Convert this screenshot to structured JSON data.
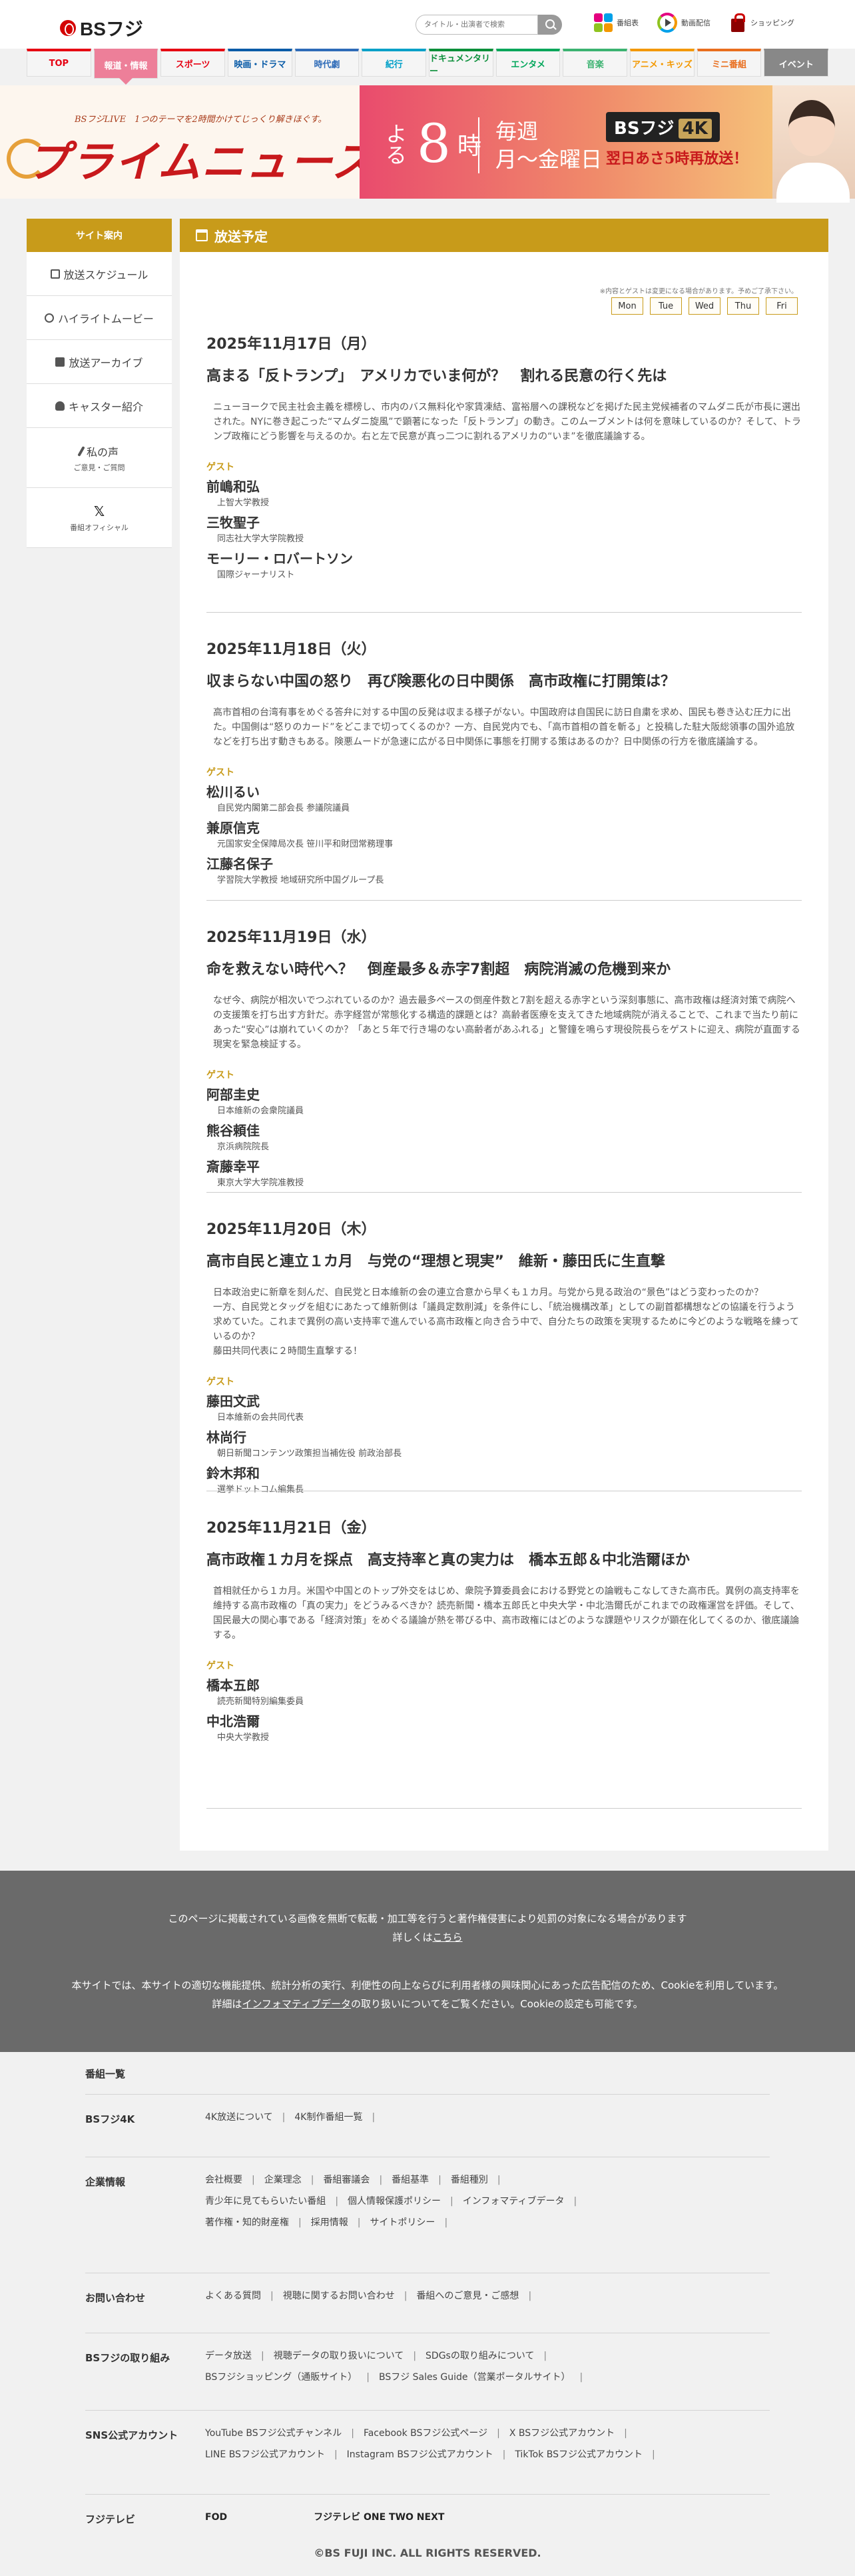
{
  "header": {
    "logo": "BSフジ",
    "search_placeholder": "タイトル・出演者で検索",
    "links": [
      {
        "label": "番組表",
        "icon": "grid-icon"
      },
      {
        "label": "動画配信",
        "icon": "play-icon"
      },
      {
        "label": "ショッピング",
        "icon": "shopping-bag-icon"
      }
    ]
  },
  "gnav": [
    {
      "label": "TOP",
      "color": "#e60012"
    },
    {
      "label": "報道・情報",
      "color": "#ed7f99"
    },
    {
      "label": "スポーツ",
      "color": "#e60012"
    },
    {
      "label": "映画・ドラマ",
      "color": "#0a5ca8"
    },
    {
      "label": "時代劇",
      "color": "#2e6bb8"
    },
    {
      "label": "紀行",
      "color": "#00a0c8"
    },
    {
      "label": "ドキュメンタリー",
      "color": "#0b8f3a"
    },
    {
      "label": "エンタメ",
      "color": "#00a65a"
    },
    {
      "label": "音楽",
      "color": "#3cb371"
    },
    {
      "label": "アニメ・キッズ",
      "color": "#f39800"
    },
    {
      "label": "ミニ番組",
      "color": "#e96e1e"
    },
    {
      "label": "イベント",
      "color": "#888888"
    }
  ],
  "banner": {
    "subtitle": "BSフジLIVE　1つのテーマを2時間かけてじっくり解きほぐす。",
    "title": "プライムニュース",
    "time_small": "よる",
    "time_big": "8",
    "time_hour": "時",
    "week_line1": "毎週",
    "week_line2": "月〜金曜日",
    "channel": "BSフジ",
    "channel_4k": "4K",
    "note": "翌日あさ5時再放送！"
  },
  "sidebar": {
    "head": "サイト案内",
    "items": [
      {
        "label": "放送スケジュール",
        "icon": "calendar-icon"
      },
      {
        "label": "ハイライトムービー",
        "icon": "play-circle-icon"
      },
      {
        "label": "放送アーカイブ",
        "icon": "book-icon"
      },
      {
        "label": "キャスター紹介",
        "icon": "person-icon"
      },
      {
        "label": "私の声",
        "sub": "ご意見・ご質問",
        "icon": "pen-icon"
      },
      {
        "label": "番組オフィシャル",
        "icon": "x-logo-icon",
        "glyph": "𝕏"
      }
    ]
  },
  "main": {
    "head": "放送予定",
    "note": "※内容とゲストは変更になる場合があります。予めご了承下さい。",
    "days": [
      "Mon",
      "Tue",
      "Wed",
      "Thu",
      "Fri"
    ],
    "guest_label": "ゲスト",
    "episodes": [
      {
        "date": "2025年11月17日（月）",
        "title": "高まる「反トランプ」　アメリカでいま何が？　割れる民意の行く先は",
        "desc": "ニューヨークで民主社会主義を標榜し、市内のバス無料化や家賃凍結、富裕層への課税などを掲げた民主党候補者のマムダニ氏が市長に選出された。NYに巻き起こった“マムダニ旋風”で顕著になった「反トランプ」の動き。このムーブメントは何を意味しているのか？そして、トランプ政権にどう影響を与えるのか。右と左で民意が真っ二つに割れるアメリカの“いま”を徹底議論する。",
        "guests": [
          {
            "name": "前嶋和弘",
            "title": "上智大学教授"
          },
          {
            "name": "三牧聖子",
            "title": "同志社大学大学院教授"
          },
          {
            "name": "モーリー・ロバートソン",
            "title": "国際ジャーナリスト"
          }
        ]
      },
      {
        "date": "2025年11月18日（火）",
        "title": "収まらない中国の怒り　再び険悪化の日中関係　高市政権に打開策は？",
        "desc": "高市首相の台湾有事をめぐる答弁に対する中国の反発は収まる様子がない。中国政府は自国民に訪日自粛を求め、国民も巻き込む圧力に出た。中国側は“怒りのカード”をどこまで切ってくるのか？一方、自民党内でも、「高市首相の首を斬る」と投稿した駐大阪総領事の国外追放などを打ち出す動きもある。険悪ムードが急速に広がる日中関係に事態を打開する策はあるのか？日中関係の行方を徹底議論する。",
        "guests": [
          {
            "name": "松川るい",
            "title": "自民党内閣第二部会長 参議院議員"
          },
          {
            "name": "兼原信克",
            "title": "元国家安全保障局次長 笹川平和財団常務理事"
          },
          {
            "name": "江藤名保子",
            "title": "学習院大学教授 地域研究所中国グループ長"
          }
        ]
      },
      {
        "date": "2025年11月19日（水）",
        "title": "命を救えない時代へ？　倒産最多＆赤字7割超　病院消滅の危機到来か",
        "desc": "なぜ今、病院が相次いでつぶれているのか？過去最多ペースの倒産件数と7割を超える赤字という深刻事態に、高市政権は経済対策で病院への支援策を打ち出す方針だ。赤字経営が常態化する構造的課題とは？高齢者医療を支えてきた地域病院が消えることで、これまで当たり前にあった“安心”は崩れていくのか？「あと５年で行き場のない高齢者があふれる」と警鐘を鳴らす現役院長らをゲストに迎え、病院が直面する現実を緊急検証する。",
        "guests": [
          {
            "name": "阿部圭史",
            "title": "日本維新の会衆院議員"
          },
          {
            "name": "熊谷頼佳",
            "title": "京浜病院院長"
          },
          {
            "name": "斎藤幸平",
            "title": "東京大学大学院准教授"
          }
        ]
      },
      {
        "date": "2025年11月20日（木）",
        "title": "高市自民と連立１カ月　与党の“理想と現実”　維新・藤田氏に生直撃",
        "desc": "日本政治史に新章を刻んだ、自民党と日本維新の会の連立合意から早くも１カ月。与党から見る政治の“景色”はどう変わったのか？\n一方、自民党とタッグを組むにあたって維新側は「議員定数削減」を条件にし、「統治機構改革」としての副首都構想などの協議を行うよう求めていた。これまで異例の高い支持率で進んでいる高市政権と向き合う中で、自分たちの政策を実現するために今どのような戦略を練っているのか？\n藤田共同代表に２時間生直撃する！",
        "guests": [
          {
            "name": "藤田文武",
            "title": "日本維新の会共同代表"
          },
          {
            "name": "林尚行",
            "title": "朝日新聞コンテンツ政策担当補佐役 前政治部長"
          },
          {
            "name": "鈴木邦和",
            "title": "選挙ドットコム編集長"
          }
        ]
      },
      {
        "date": "2025年11月21日（金）",
        "title": "高市政権１カ月を採点　高支持率と真の実力は　橋本五郎＆中北浩爾ほか",
        "desc": "首相就任から１カ月。米国や中国とのトップ外交をはじめ、衆院予算委員会における野党との論戦もこなしてきた高市氏。異例の高支持率を維持する高市政権の「真の実力」をどうみるべきか？読売新聞・橋本五郎氏と中央大学・中北浩爾氏がこれまでの政権運営を評価。そして、国民最大の関心事である「経済対策」をめぐる議論が熱を帯びる中、高市政権にはどのような課題やリスクが顕在化してくるのか、徹底議論する。",
        "guests": [
          {
            "name": "橋本五郎",
            "title": "読売新聞特別編集委員"
          },
          {
            "name": "中北浩爾",
            "title": "中央大学教授"
          }
        ]
      }
    ]
  },
  "notice": {
    "line1": "このページに掲載されている画像を無断で転載・加工等を行うと著作権侵害により処罰の対象になる場合があります",
    "line2_pre": "詳しくは",
    "line2_link": "こちら",
    "line3": "本サイトでは、本サイトの適切な機能提供、統計分析の実行、利便性の向上ならびに利用者様の興味関心にあった広告配信のため、Cookieを利用しています。",
    "line4_pre": "詳細は",
    "line4_link": "インフォマティブデータ",
    "line4_post": "の取り扱いについてをご覧ください。Cookieの設定も可能です。"
  },
  "footer": {
    "rows": [
      {
        "head": "番組一覧",
        "links": []
      },
      {
        "head": "BSフジ4K",
        "links": [
          [
            "4K放送について",
            "4K制作番組一覧"
          ]
        ]
      },
      {
        "head": "企業情報",
        "links": [
          [
            "会社概要",
            "企業理念",
            "番組審議会",
            "番組基準",
            "番組種別"
          ],
          [
            "青少年に見てもらいたい番組",
            "個人情報保護ポリシー",
            "インフォマティブデータ"
          ],
          [
            "著作権・知的財産権",
            "採用情報",
            "サイトポリシー"
          ]
        ]
      },
      {
        "head": "お問い合わせ",
        "links": [
          [
            "よくある質問",
            "視聴に関するお問い合わせ",
            "番組へのご意見・ご感想"
          ]
        ]
      },
      {
        "head": "BSフジの取り組み",
        "links": [
          [
            "データ放送",
            "視聴データの取り扱いについて",
            "SDGsの取り組みについて"
          ],
          [
            "BSフジショッピング（通販サイト）",
            "BSフジ Sales Guide（営業ポータルサイト）"
          ]
        ]
      },
      {
        "head": "SNS公式アカウント",
        "links": [
          [
            "YouTube BSフジ公式チャンネル",
            "Facebook BSフジ公式ページ",
            "X BSフジ公式アカウント"
          ],
          [
            "LINE BSフジ公式アカウント",
            "Instagram BSフジ公式アカウント",
            "TikTok BSフジ公式アカウント"
          ]
        ]
      },
      {
        "head": "フジテレビ",
        "links": [],
        "extra": [
          "FOD",
          "フジテレビ ONE TWO NEXT"
        ]
      }
    ],
    "copyright": "©BS FUJI INC. ALL RIGHTS RESERVED."
  }
}
